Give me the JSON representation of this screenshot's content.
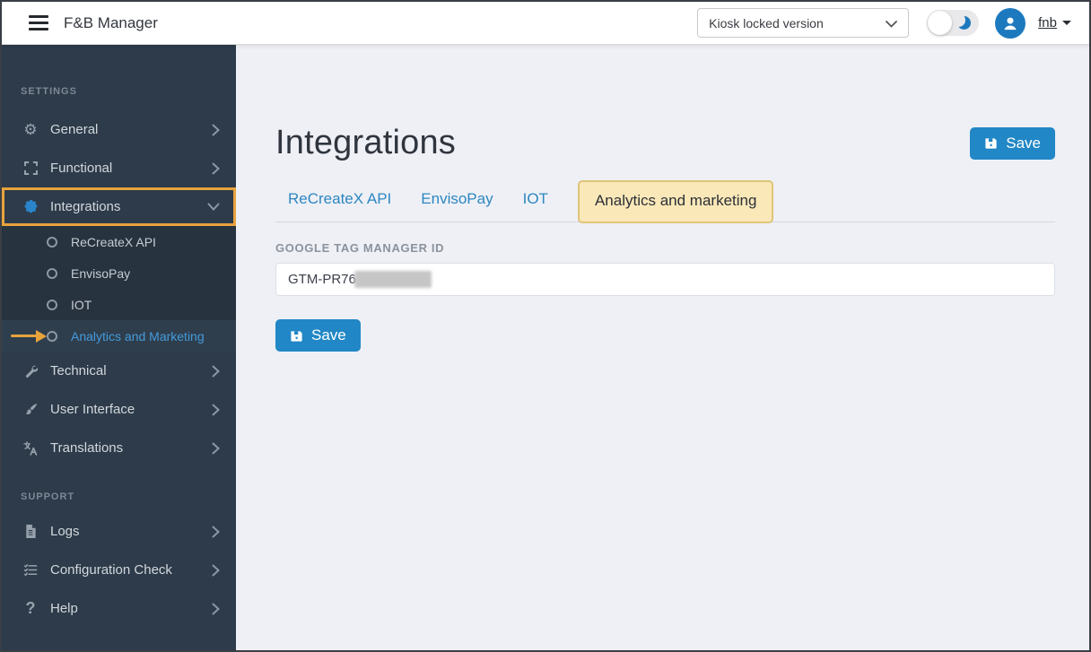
{
  "header": {
    "title": "F&B Manager",
    "version_select_value": "Kiosk locked version",
    "username": "fnb"
  },
  "sidebar": {
    "section_settings": "SETTINGS",
    "section_support": "SUPPORT",
    "items": {
      "general": "General",
      "functional": "Functional",
      "integrations": "Integrations",
      "recreatex": "ReCreateX API",
      "envisopay": "EnvisoPay",
      "iot": "IOT",
      "analytics": "Analytics and Marketing",
      "technical": "Technical",
      "user_interface": "User Interface",
      "translations": "Translations",
      "logs": "Logs",
      "config_check": "Configuration Check",
      "help": "Help"
    }
  },
  "main": {
    "title": "Integrations",
    "save_label": "Save",
    "tabs": [
      "ReCreateX API",
      "EnvisoPay",
      "IOT",
      "Analytics and marketing"
    ],
    "gtm": {
      "label": "GOOGLE TAG MANAGER ID",
      "value": "GTM-PR76"
    }
  },
  "colors": {
    "accent_blue": "#2187c6",
    "link_blue": "#2e86c1",
    "sidebar_bg": "#2d3b4a",
    "submenu_bg": "#27333f",
    "active_item_blue": "#449bdc",
    "annotation_orange": "#e8a33d",
    "tab_highlight_bg": "#fae8b8",
    "content_bg": "#eef0f6",
    "avatar_blue": "#1d79be"
  }
}
